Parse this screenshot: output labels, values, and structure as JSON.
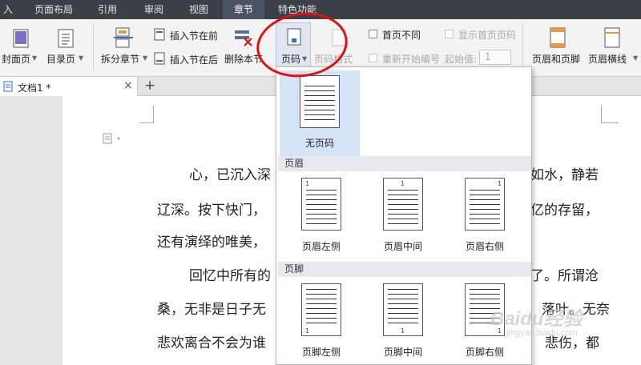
{
  "menu": {
    "tabs": [
      {
        "label": "入",
        "active": false
      },
      {
        "label": "页面布局",
        "active": false
      },
      {
        "label": "引用",
        "active": false
      },
      {
        "label": "审阅",
        "active": false
      },
      {
        "label": "视图",
        "active": false
      },
      {
        "label": "章节",
        "active": true
      },
      {
        "label": "特色功能",
        "active": false
      }
    ]
  },
  "ribbon": {
    "cover_page": "封面页",
    "toc_page": "目录页",
    "split_section": "拆分章节",
    "insert_section_before": "插入节在前",
    "insert_section_after": "插入节在后",
    "delete_section": "删除本节",
    "page_number": "页码",
    "page_number_format": "页码格式",
    "first_page_different": "首页不同",
    "show_first_page_number": "显示首页页码",
    "restart_numbering": "重新开始编号",
    "start_value_label": "起始值:",
    "start_value": "1",
    "header_footer": "页眉和页脚",
    "header_line": "页眉横线"
  },
  "doc_tab": {
    "title": "文档1 *",
    "close_glyph": "×",
    "new_tab_glyph": "+"
  },
  "document": {
    "lines": [
      "心，已沉入深",
      "如水，静若",
      "辽深。按下快门，",
      "亿的存留，",
      "还有演绎的唯美，",
      "回忆中所有的",
      "了。所谓沧",
      "桑，无非是日子无",
      "落叶。无奈",
      "悲欢离合不会为谁",
      "悲伤，都"
    ]
  },
  "dropdown": {
    "none_label": "无页码",
    "header_section": "页眉",
    "footer_section": "页脚",
    "header_options": [
      "页眉左侧",
      "页眉中间",
      "页眉右侧"
    ],
    "footer_options": [
      "页脚左侧",
      "页脚中间",
      "页脚右侧"
    ],
    "sample_number": "1"
  },
  "watermark": {
    "brand": "Baidu经验",
    "url": "jingyan.baidu.com"
  },
  "colors": {
    "menubar": "#3a3f48",
    "selected_option": "#d6e3f6",
    "annotation_circle": "#e01010"
  }
}
